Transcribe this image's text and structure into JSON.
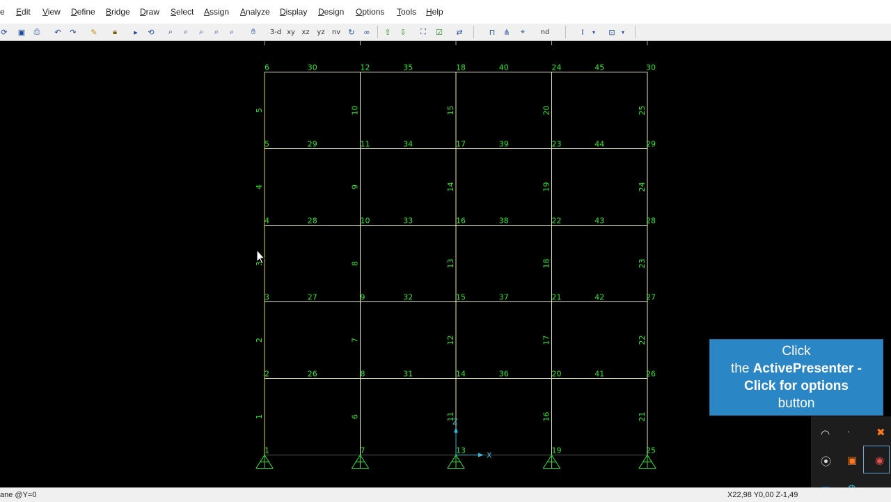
{
  "menu": {
    "items": [
      {
        "label": "File",
        "shown": "e",
        "underline": ""
      },
      {
        "label": "Edit",
        "shown": "Edit",
        "underline": "E",
        "rest": "dit"
      },
      {
        "label": "View",
        "underline": "V",
        "rest": "iew"
      },
      {
        "label": "Define",
        "underline": "D",
        "rest": "efine"
      },
      {
        "label": "Bridge",
        "underline": "B",
        "rest": "ridge"
      },
      {
        "label": "Draw",
        "underline": "D",
        "rest": "raw"
      },
      {
        "label": "Select",
        "underline": "S",
        "rest": "elect"
      },
      {
        "label": "Assign",
        "underline": "A",
        "rest": "ssign"
      },
      {
        "label": "Analyze",
        "underline": "A",
        "rest": "nalyze"
      },
      {
        "label": "Display",
        "underline": "D",
        "rest": "isplay"
      },
      {
        "label": "Design",
        "underline": "D",
        "rest": "esign"
      },
      {
        "label": "Options",
        "underline": "O",
        "rest": "ptions"
      },
      {
        "label": "Tools",
        "underline": "T",
        "rest": "ools"
      },
      {
        "label": "Help",
        "underline": "H",
        "rest": "elp"
      }
    ]
  },
  "toolbar": {
    "view_3d": "3-d",
    "view_xy": "xy",
    "view_xz": "xz",
    "view_yz": "yz",
    "view_nv": "nv",
    "view_nd": "nd"
  },
  "model": {
    "columns_x": [
      0,
      1,
      2,
      3,
      4
    ],
    "levels_z": [
      0,
      1,
      2,
      3,
      4,
      5
    ],
    "joint_labels": [
      [
        "1",
        "2",
        "3",
        "4",
        "5",
        "6"
      ],
      [
        "7",
        "8",
        "9",
        "10",
        "11",
        "12"
      ],
      [
        "13",
        "14",
        "15",
        "16",
        "17",
        "18"
      ],
      [
        "19",
        "20",
        "21",
        "22",
        "23",
        "24"
      ],
      [
        "25",
        "26",
        "27",
        "28",
        "29",
        "30"
      ]
    ],
    "column_frame_labels": [
      [
        "1",
        "2",
        "3",
        "4",
        "5"
      ],
      [
        "6",
        "7",
        "8",
        "9",
        "10"
      ],
      [
        "11",
        "12",
        "13",
        "14",
        "15"
      ],
      [
        "16",
        "17",
        "18",
        "19",
        "20"
      ],
      [
        "21",
        "22",
        "23",
        "24",
        "25"
      ]
    ],
    "beam_frame_labels": [
      [
        "26",
        "27",
        "28",
        "29",
        "30"
      ],
      [
        "31",
        "32",
        "33",
        "34",
        "35"
      ],
      [
        "36",
        "37",
        "38",
        "39",
        "40"
      ],
      [
        "41",
        "42",
        "43",
        "44",
        "45"
      ]
    ],
    "axis_z": "Z",
    "axis_x": "X",
    "colors": {
      "frame": "#e8e8b0",
      "label": "#2ee82e",
      "column_edge": "#d8d840",
      "axis": "#35b8d8",
      "support": "#2ee82e"
    }
  },
  "status": {
    "left": "ane @Y=0",
    "right": "X22,98  Y0,00  Z-1,49"
  },
  "callout": {
    "line1": "Click",
    "line2_prefix": "the ",
    "line2_bold": "ActivePresenter -",
    "line3_bold": "Click for options",
    "line4": "button"
  },
  "tray": {
    "icons": [
      "wifi-icon",
      "gear-icon",
      "speaker-icon",
      "orange-app-icon",
      "activepresenter-icon",
      "zoom-icon",
      "chrome-icon"
    ]
  }
}
